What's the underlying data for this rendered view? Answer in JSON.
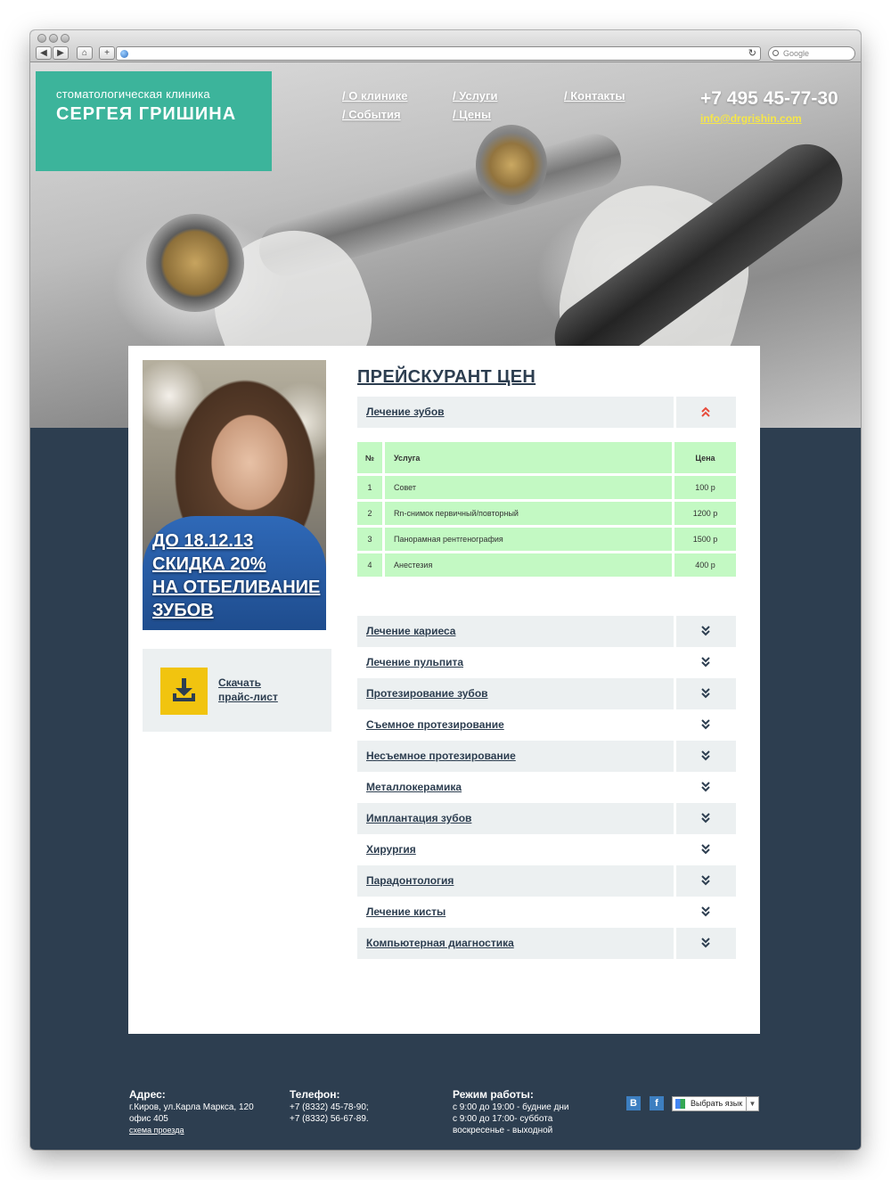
{
  "browser": {
    "search_placeholder": "Google"
  },
  "header": {
    "logo_sub": "стоматологическая клиника",
    "logo_name": "СЕРГЕЯ ГРИШИНА",
    "nav": [
      {
        "label": "/ О клинике"
      },
      {
        "label": "/ События"
      },
      {
        "label": "/ Услуги"
      },
      {
        "label": "/ Цены"
      },
      {
        "label": "/ Контакты"
      }
    ],
    "phone": "+7 495 45-77-30",
    "email": "info@drgrishin.com"
  },
  "promo": {
    "lines": [
      "ДО 18.12.13",
      "СКИДКА 20%",
      "НА ОТБЕЛИВАНИЕ",
      "ЗУБОВ"
    ]
  },
  "download": {
    "line1": "Скачать",
    "line2": "прайс-лист"
  },
  "pricelist": {
    "title": "ПРЕЙСКУРАНТ ЦЕН",
    "open_section": "Лечение зубов",
    "table": {
      "headers": [
        "№",
        "Услуга",
        "Цена"
      ],
      "rows": [
        [
          "1",
          "Совет",
          "100 р"
        ],
        [
          "2",
          "Rn-снимок первичный/повторный",
          "1200 р"
        ],
        [
          "3",
          "Панорамная рентгенография",
          "1500 р"
        ],
        [
          "4",
          "Анестезия",
          "400 р"
        ]
      ]
    },
    "sections": [
      "Лечение кариеса",
      "Лечение пульпита",
      "Протезирование зубов",
      "Съемное протезирование",
      "Несъемное протезирование",
      "Металлокерамика",
      "Имплантация зубов",
      "Хирургия",
      "Парадонтология",
      "Лечение кисты",
      "Компьютерная диагностика"
    ]
  },
  "footer": {
    "address_title": "Адрес:",
    "address_line1": "г.Киров, ул.Карла Маркса, 120",
    "address_line2": "офис 405",
    "address_link": "схема проезда",
    "phone_title": "Телефон:",
    "phone_line1": "+7 (8332) 45-78-90;",
    "phone_line2": "+7 (8332) 56-67-89.",
    "hours_title": "Режим работы:",
    "hours_line1": "с 9:00 до 19:00 - будние дни",
    "hours_line2": "с 9:00 до 17:00- суббота",
    "hours_line3": "воскресенье - выходной",
    "social_vk": "B",
    "social_fb": "f",
    "lang_label": "Выбрать язык"
  },
  "colors": {
    "accent": "#3cb49b",
    "dark": "#2d3e50",
    "table_green": "#c3f9c3",
    "download_icon": "#f1c40f",
    "email": "#f5e64a"
  }
}
